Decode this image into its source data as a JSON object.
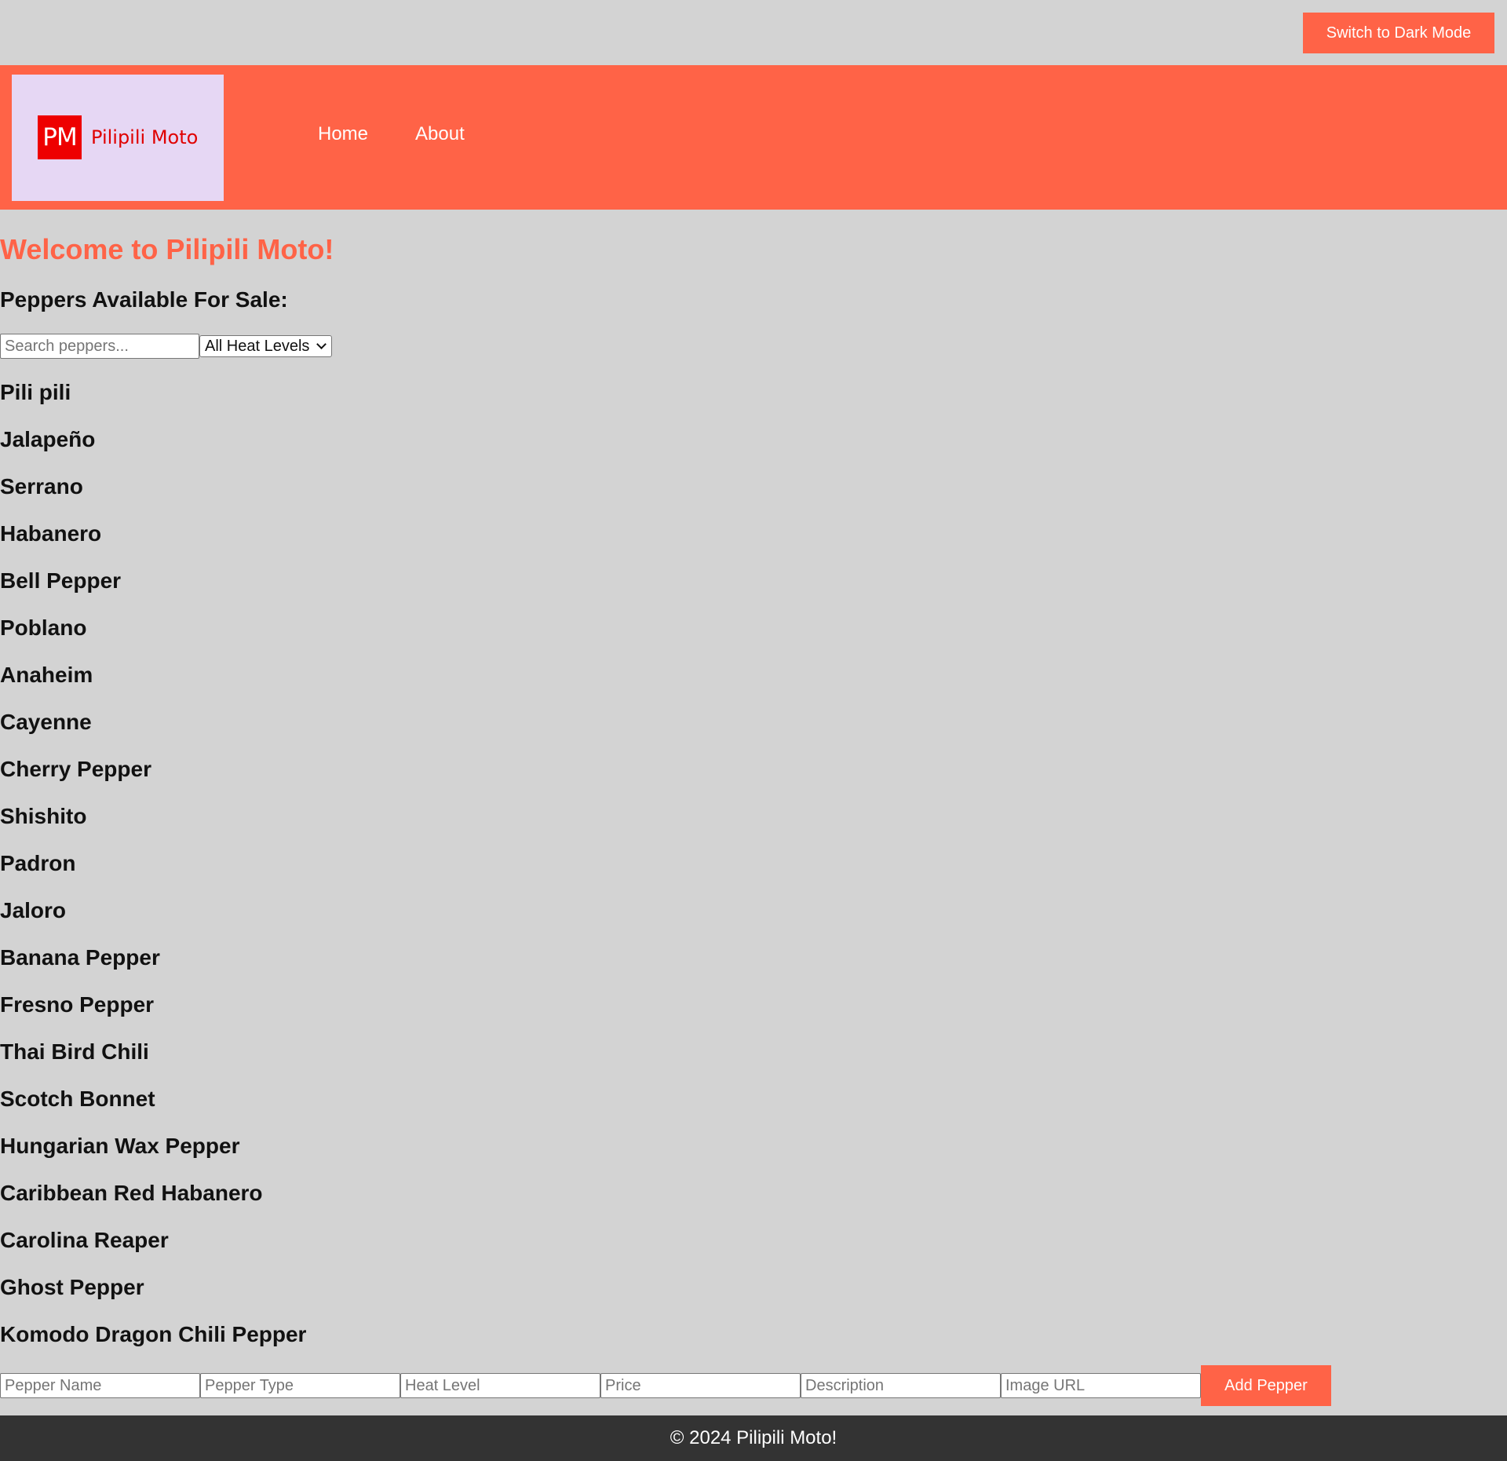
{
  "topbar": {
    "dark_mode_label": "Switch to Dark Mode"
  },
  "header": {
    "logo_mark": "PM",
    "logo_text": "Pilipili Moto",
    "nav": [
      {
        "label": "Home"
      },
      {
        "label": "About"
      }
    ]
  },
  "main": {
    "welcome": "Welcome to Pilipili Moto!",
    "subheading": "Peppers Available For Sale:",
    "search_placeholder": "Search peppers...",
    "heat_filter_value": "All Heat Levels",
    "peppers": [
      "Pili pili",
      "Jalapeño",
      "Serrano",
      "Habanero",
      "Bell Pepper",
      "Poblano",
      "Anaheim",
      "Cayenne",
      "Cherry Pepper",
      "Shishito",
      "Padron",
      "Jaloro",
      "Banana Pepper",
      "Fresno Pepper",
      "Thai Bird Chili",
      "Scotch Bonnet",
      "Hungarian Wax Pepper",
      "Caribbean Red Habanero",
      "Carolina Reaper",
      "Ghost Pepper",
      "Komodo Dragon Chili Pepper"
    ]
  },
  "add_form": {
    "placeholders": {
      "name": "Pepper Name",
      "type": "Pepper Type",
      "heat": "Heat Level",
      "price": "Price",
      "description": "Description",
      "image": "Image URL"
    },
    "submit_label": "Add Pepper"
  },
  "footer": {
    "text": "© 2024 Pilipili Moto!"
  },
  "colors": {
    "accent": "#ff6347",
    "background": "#d3d3d3",
    "logo_bg": "#e6d7f4",
    "logo_red": "#ee0000",
    "footer_bg": "#333333"
  }
}
